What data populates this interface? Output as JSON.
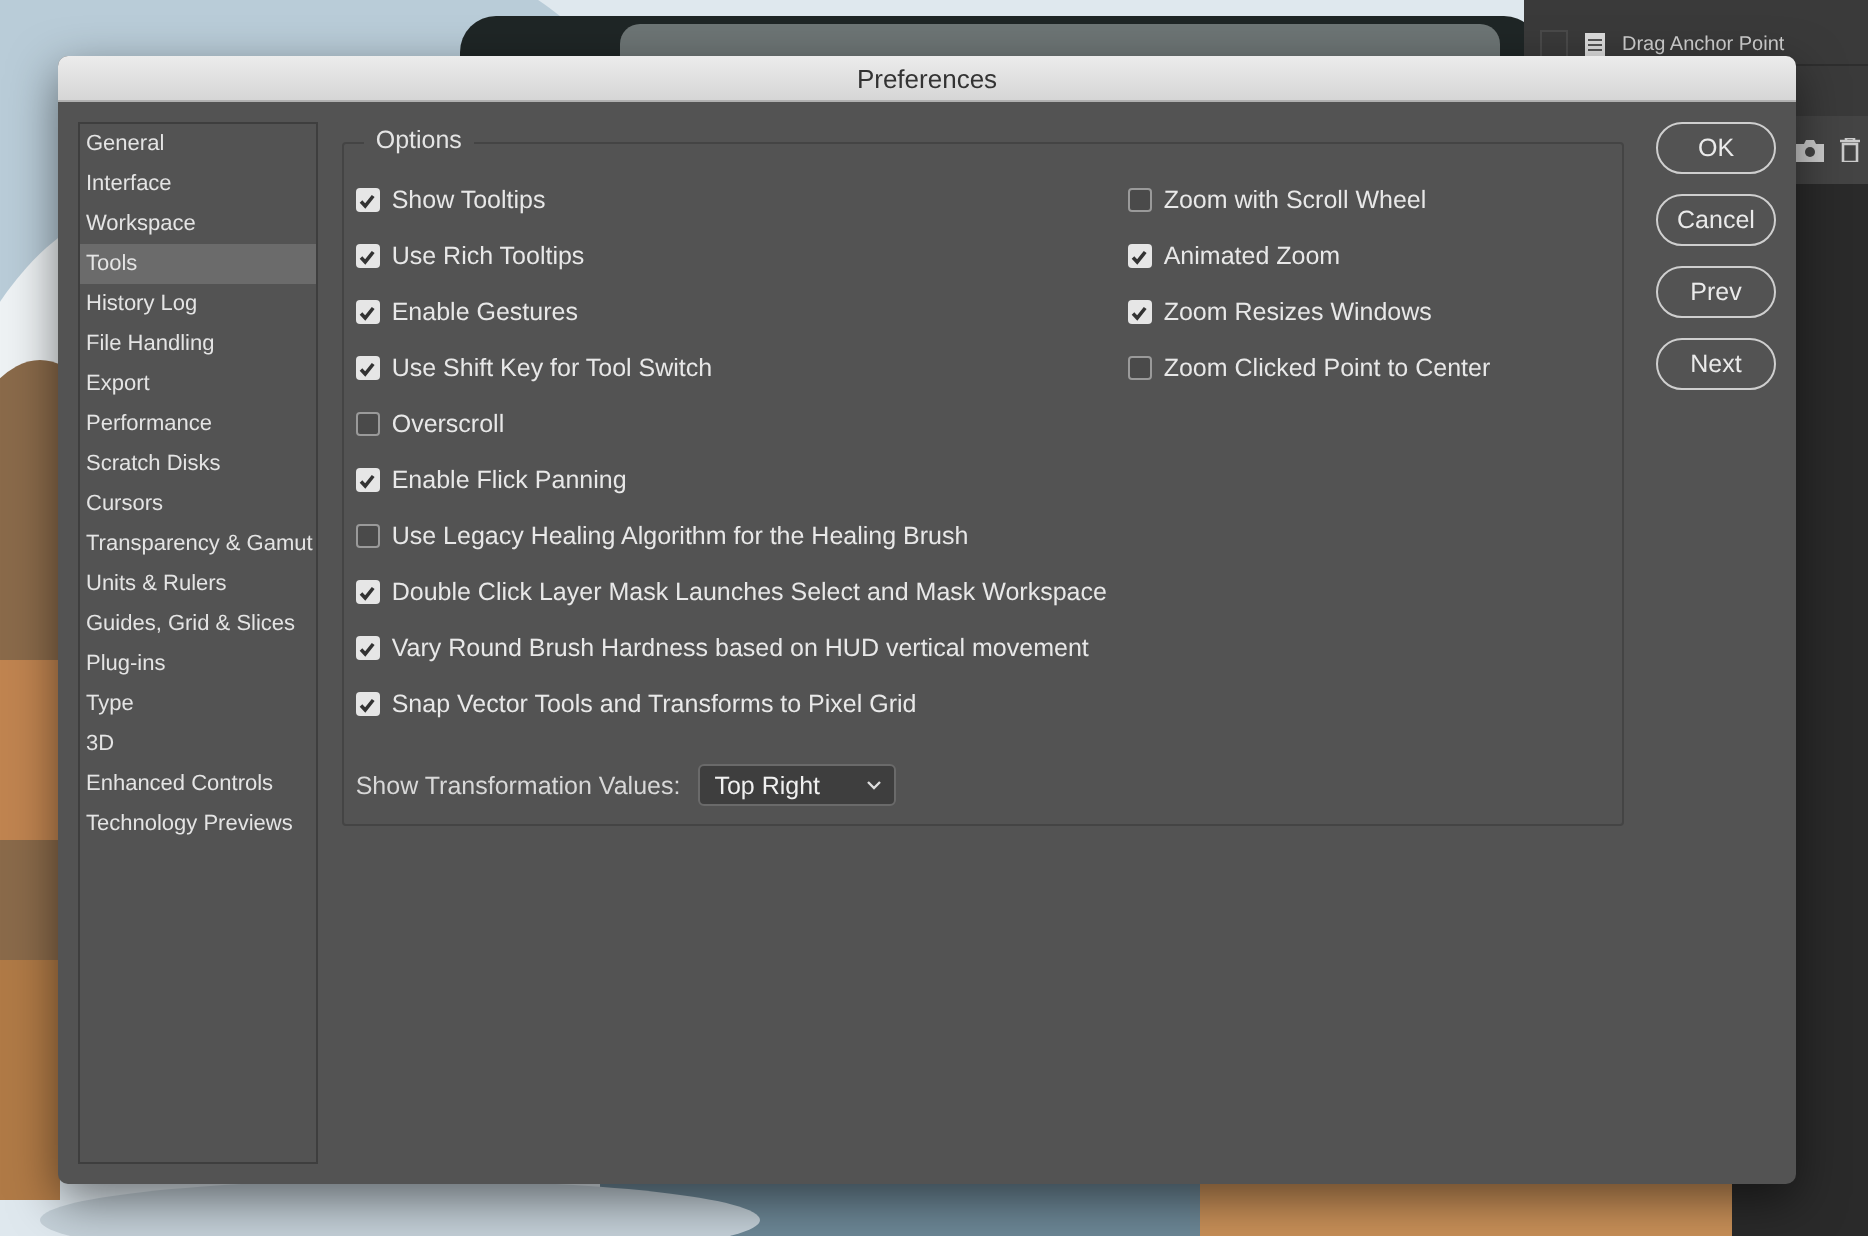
{
  "background_panel": {
    "items": [
      {
        "label": "Drag Anchor Point"
      }
    ]
  },
  "window": {
    "title": "Preferences"
  },
  "sidebar": {
    "items": [
      {
        "label": "General",
        "selected": false
      },
      {
        "label": "Interface",
        "selected": false
      },
      {
        "label": "Workspace",
        "selected": false
      },
      {
        "label": "Tools",
        "selected": true
      },
      {
        "label": "History Log",
        "selected": false
      },
      {
        "label": "File Handling",
        "selected": false
      },
      {
        "label": "Export",
        "selected": false
      },
      {
        "label": "Performance",
        "selected": false
      },
      {
        "label": "Scratch Disks",
        "selected": false
      },
      {
        "label": "Cursors",
        "selected": false
      },
      {
        "label": "Transparency & Gamut",
        "selected": false
      },
      {
        "label": "Units & Rulers",
        "selected": false
      },
      {
        "label": "Guides, Grid & Slices",
        "selected": false
      },
      {
        "label": "Plug-ins",
        "selected": false
      },
      {
        "label": "Type",
        "selected": false
      },
      {
        "label": "3D",
        "selected": false
      },
      {
        "label": "Enhanced Controls",
        "selected": false
      },
      {
        "label": "Technology Previews",
        "selected": false
      }
    ]
  },
  "options": {
    "title": "Options",
    "left_column": [
      {
        "label": "Show Tooltips",
        "checked": true
      },
      {
        "label": "Use Rich Tooltips",
        "checked": true
      },
      {
        "label": "Enable Gestures",
        "checked": true
      },
      {
        "label": "Use Shift Key for Tool Switch",
        "checked": true
      },
      {
        "label": "Overscroll",
        "checked": false
      },
      {
        "label": "Enable Flick Panning",
        "checked": true
      },
      {
        "label": "Use Legacy Healing Algorithm for the Healing Brush",
        "checked": false
      },
      {
        "label": "Double Click Layer Mask Launches Select and Mask Workspace",
        "checked": true
      },
      {
        "label": "Vary Round Brush Hardness based on HUD vertical movement",
        "checked": true
      },
      {
        "label": "Snap Vector Tools and Transforms to Pixel Grid",
        "checked": true
      }
    ],
    "right_column": [
      {
        "label": "Zoom with Scroll Wheel",
        "checked": false
      },
      {
        "label": "Animated Zoom",
        "checked": true
      },
      {
        "label": "Zoom Resizes Windows",
        "checked": true
      },
      {
        "label": "Zoom Clicked Point to Center",
        "checked": false
      }
    ],
    "transformation_values": {
      "label": "Show Transformation Values:",
      "value": "Top Right"
    }
  },
  "buttons": [
    "OK",
    "Cancel",
    "Prev",
    "Next"
  ]
}
